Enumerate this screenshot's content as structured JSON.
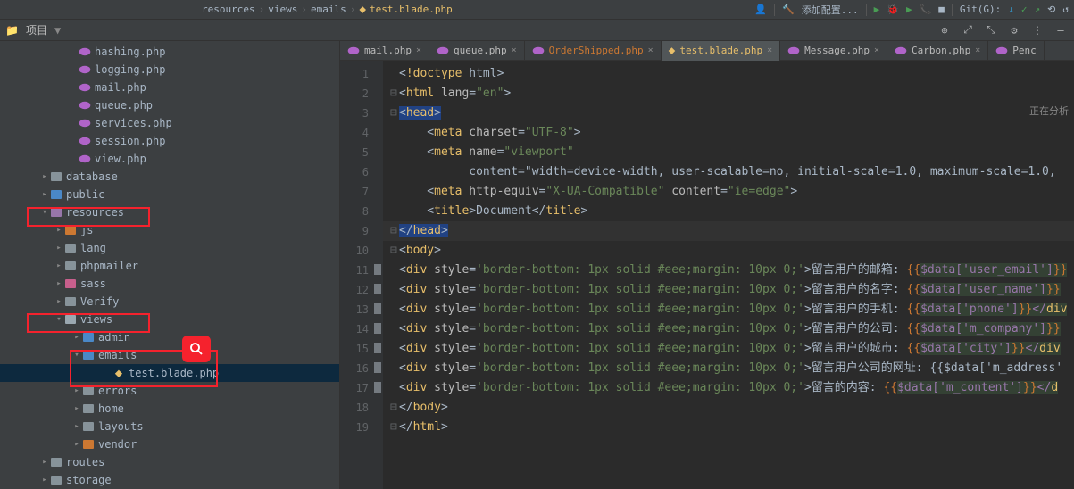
{
  "breadcrumb": [
    "resources",
    "views",
    "emails",
    "test.blade.php"
  ],
  "toolbar_right": {
    "add_config": "添加配置...",
    "git": "Git(G):"
  },
  "project_panel": {
    "title": "项目"
  },
  "tree_items": [
    {
      "pad": 76,
      "icon": "php",
      "label": "hashing.php"
    },
    {
      "pad": 76,
      "icon": "php",
      "label": "logging.php"
    },
    {
      "pad": 76,
      "icon": "php",
      "label": "mail.php"
    },
    {
      "pad": 76,
      "icon": "php",
      "label": "queue.php"
    },
    {
      "pad": 76,
      "icon": "php",
      "label": "services.php"
    },
    {
      "pad": 76,
      "icon": "php",
      "label": "session.php"
    },
    {
      "pad": 76,
      "icon": "php",
      "label": "view.php"
    },
    {
      "pad": 44,
      "arrow": ">",
      "icon": "folder",
      "label": "database"
    },
    {
      "pad": 44,
      "arrow": ">",
      "icon": "folder-blue",
      "label": "public"
    },
    {
      "pad": 44,
      "arrow": "v",
      "icon": "folder-purple",
      "label": "resources"
    },
    {
      "pad": 60,
      "arrow": ">",
      "icon": "folder-orange",
      "label": "js"
    },
    {
      "pad": 60,
      "arrow": ">",
      "icon": "folder",
      "label": "lang"
    },
    {
      "pad": 60,
      "arrow": ">",
      "icon": "folder",
      "label": "phpmailer"
    },
    {
      "pad": 60,
      "arrow": ">",
      "icon": "folder-pink",
      "label": "sass"
    },
    {
      "pad": 60,
      "arrow": ">",
      "icon": "folder",
      "label": "Verify"
    },
    {
      "pad": 60,
      "arrow": "v",
      "icon": "folder-open",
      "label": "views"
    },
    {
      "pad": 80,
      "arrow": ">",
      "icon": "folder-blue",
      "label": "admin"
    },
    {
      "pad": 80,
      "arrow": "v",
      "icon": "folder-blue",
      "label": "emails"
    },
    {
      "pad": 114,
      "icon": "html",
      "label": "test.blade.php"
    },
    {
      "pad": 80,
      "arrow": ">",
      "icon": "folder",
      "label": "errors"
    },
    {
      "pad": 80,
      "arrow": ">",
      "icon": "folder",
      "label": "home"
    },
    {
      "pad": 80,
      "arrow": ">",
      "icon": "folder",
      "label": "layouts"
    },
    {
      "pad": 80,
      "arrow": ">",
      "icon": "folder-orange",
      "label": "vendor"
    },
    {
      "pad": 44,
      "arrow": ">",
      "icon": "folder",
      "label": "routes"
    },
    {
      "pad": 44,
      "arrow": ">",
      "icon": "folder",
      "label": "storage"
    }
  ],
  "tabs": [
    {
      "icon": "php",
      "name": "mail.php",
      "cls": "tab-name-normal"
    },
    {
      "icon": "php",
      "name": "queue.php",
      "cls": "tab-name-normal"
    },
    {
      "icon": "php",
      "name": "OrderShipped.php",
      "cls": "tab-name-orange"
    },
    {
      "icon": "html",
      "name": "test.blade.php",
      "cls": "tab-name-yellow",
      "active": true
    },
    {
      "icon": "php",
      "name": "Message.php",
      "cls": "tab-name-normal"
    },
    {
      "icon": "php",
      "name": "Carbon.php",
      "cls": "tab-name-normal"
    },
    {
      "icon": "php",
      "name": "Penc",
      "cls": "tab-name-normal",
      "overflow": true
    }
  ],
  "status": "正在分析",
  "code_lines": [
    "<!doctype html>",
    "<html lang=\"en\">",
    "<head>",
    "    <meta charset=\"UTF-8\">",
    "    <meta name=\"viewport\"",
    "          content=\"width=device-width, user-scalable=no, initial-scale=1.0, maximum-scale=1.0,",
    "    <meta http-equiv=\"X-UA-Compatible\" content=\"ie=edge\">",
    "    <title>Document</title>",
    "</head>",
    "<body>",
    "<div style='border-bottom: 1px solid #eee;margin: 10px 0;'>留言用户的邮箱: {{$data['user_email']}}",
    "<div style='border-bottom: 1px solid #eee;margin: 10px 0;'>留言用户的名字: {{$data['user_name']}}",
    "<div style='border-bottom: 1px solid #eee;margin: 10px 0;'>留言用户的手机: {{$data['phone']}}</div",
    "<div style='border-bottom: 1px solid #eee;margin: 10px 0;'>留言用户的公司: {{$data['m_company']}}",
    "<div style='border-bottom: 1px solid #eee;margin: 10px 0;'>留言用户的城市: {{$data['city']}}</div",
    "<div style='border-bottom: 1px solid #eee;margin: 10px 0;'>留言用户公司的网址: {{$data['m_address'",
    "<div style='border-bottom: 1px solid #eee;margin: 10px 0;'>留言的内容: {{$data['m_content']}}</d",
    "</body>",
    "</html>"
  ]
}
